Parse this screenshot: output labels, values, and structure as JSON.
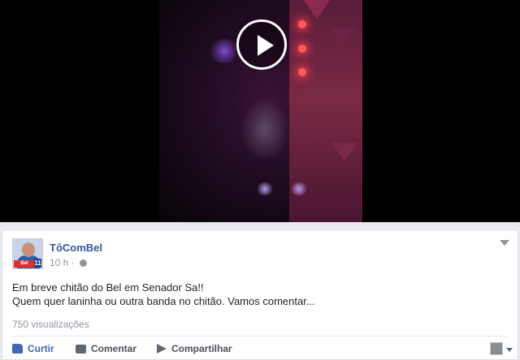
{
  "post": {
    "page_name": "TôComBel",
    "time": "10 h",
    "separator": "·",
    "text_line1": "Em breve chitão do Bel em Senador Sa!!",
    "text_line2": "Quem quer laninha ou outra banda no chitão. Vamos comentar...",
    "views": "750 visualizações"
  },
  "actions": {
    "like": "Curtir",
    "comment": "Comentar",
    "share": "Compartilhar"
  },
  "avatar": {
    "badge_text": "Bel Júnior",
    "badge_number": "11"
  },
  "icons": {
    "play": "play-icon",
    "privacy": "globe-icon",
    "menu": "chevron-down-icon",
    "like": "thumbs-up-icon",
    "comment": "comment-icon",
    "share": "share-arrow-icon"
  },
  "colors": {
    "link": "#365899",
    "accent": "#4267b2",
    "muted": "#90949c",
    "text": "#1d2129"
  }
}
